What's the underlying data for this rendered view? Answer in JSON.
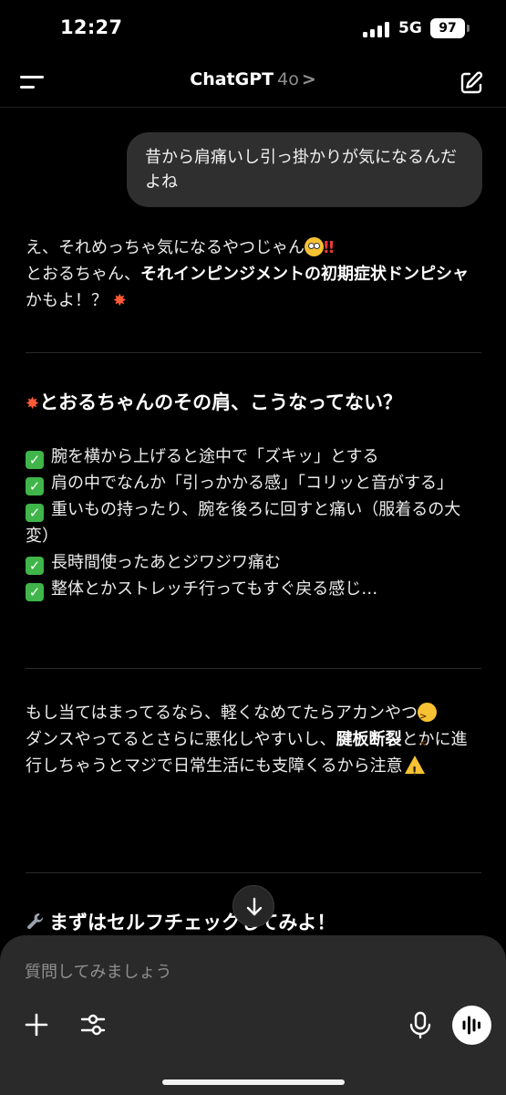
{
  "status_bar": {
    "time": "12:27",
    "network": "5G",
    "battery": "97"
  },
  "header": {
    "title": "ChatGPT",
    "model": "4o",
    "chevron": ">"
  },
  "user_message": "昔から肩痛いし引っ掛かりが気になるんだよね",
  "assistant": {
    "intro_line1": "え、それめっちゃ気になるやつじゃん",
    "intro_excl": "‼",
    "intro_line2_a": "とおるちゃん、",
    "intro_line2_bold": "それインピンジメントの初期症状ドンピシャ",
    "intro_line2_b": "かもよ！？",
    "section1_heading": "とおるちゃんのその肩、こうなってない？",
    "checklist": [
      "腕を横から上げると途中で「ズキッ」とする",
      "肩の中でなんか「引っかかる感」「コリッと音がする」",
      "重いもの持ったり、腕を後ろに回すと痛い（服着るの大変）",
      "長時間使ったあとジワジワ痛む",
      "整体とかストレッチ行ってもすぐ戻る感じ…"
    ],
    "warning_line1": "もし当てはまってるなら、軽くなめてたらアカンやつ",
    "warning_line2_a": "ダンスやってるとさらに悪化しやすいし、",
    "warning_line2_bold": "腱板断裂",
    "warning_line2_b": "とかに進行しちゃうとマジで日常生活にも支障くるから注意",
    "section2_heading": "まずはセルフチェックしてみよ！"
  },
  "composer": {
    "placeholder": "質問してみましょう"
  },
  "icons": {
    "menu": "menu-icon",
    "edit": "new-chat-icon",
    "scroll_down": "arrow-down-icon",
    "plus": "plus-icon",
    "tools": "sliders-icon",
    "mic": "microphone-icon",
    "voice": "voice-waveform-icon",
    "check": "check-box-icon",
    "wrench": "wrench-icon"
  },
  "colors": {
    "background": "#000000",
    "bubble": "#2f2f2f",
    "composer": "#2a2a2a",
    "check_green": "#3fb54a"
  }
}
